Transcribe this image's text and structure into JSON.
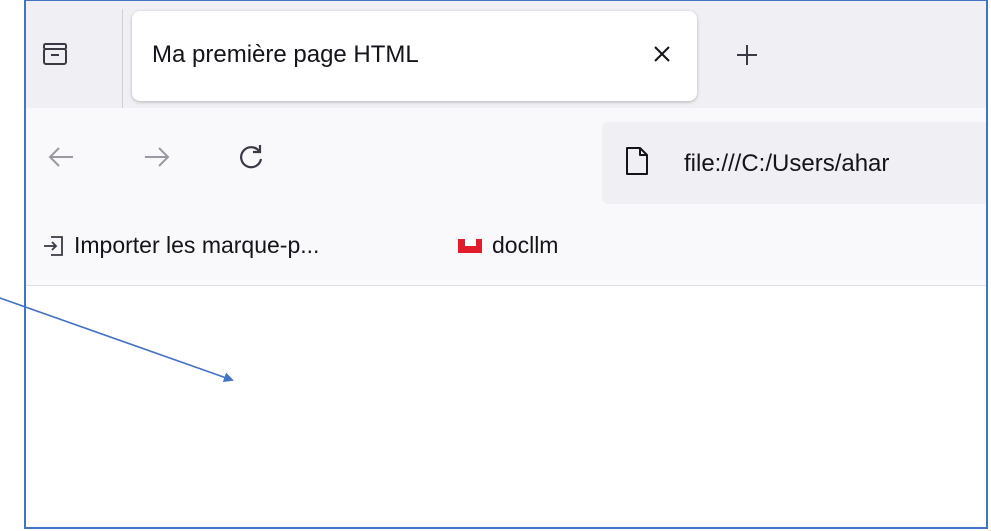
{
  "tab": {
    "title": "Ma première page HTML",
    "close_icon": "close-icon",
    "new_tab_icon": "plus-icon",
    "overview_icon": "tab-overview-icon"
  },
  "navbar": {
    "back_icon": "back-arrow-icon",
    "forward_icon": "forward-arrow-icon",
    "reload_icon": "reload-icon",
    "url": "file:///C:/Users/ahar",
    "page_icon": "page-icon"
  },
  "bookmarks": {
    "import_label": "Importer les marque-p...",
    "import_icon": "import-icon",
    "doclm_label": "docllm",
    "doclm_icon": "docllm-icon",
    "doclm_color": "#e11d2b"
  },
  "annotation": {
    "arrow_color": "#4472c4"
  },
  "colors": {
    "frame_border": "#4472c4",
    "tabstrip_bg": "#f0f0f4",
    "navbar_bg": "#f9f9fb"
  }
}
